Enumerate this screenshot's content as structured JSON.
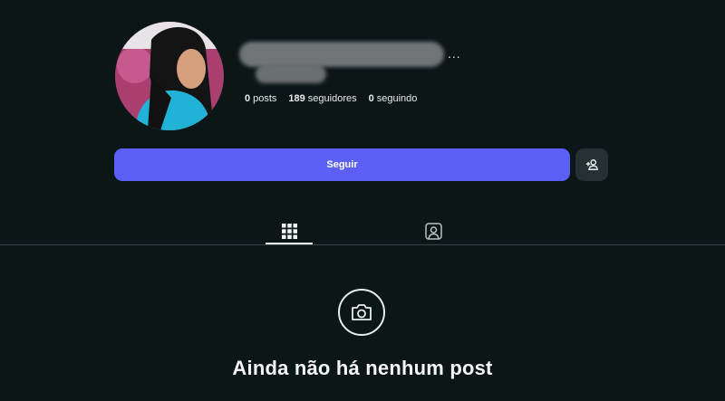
{
  "profile": {
    "more_label": "...",
    "stats": [
      {
        "value": "0",
        "label": "posts"
      },
      {
        "value": "189",
        "label": "seguidores"
      },
      {
        "value": "0",
        "label": "seguindo"
      }
    ]
  },
  "actions": {
    "follow_label": "Seguir",
    "suggest_icon": "person-add-icon"
  },
  "tabs": [
    {
      "icon": "grid-icon",
      "active": true
    },
    {
      "icon": "tagged-icon",
      "active": false
    }
  ],
  "empty_state": {
    "icon": "camera-icon",
    "title": "Ainda não há nenhum post"
  },
  "colors": {
    "background": "#0b1617",
    "primary_button": "#5b5ff5",
    "secondary_button": "#262f31",
    "text": "#f2f5f5"
  }
}
